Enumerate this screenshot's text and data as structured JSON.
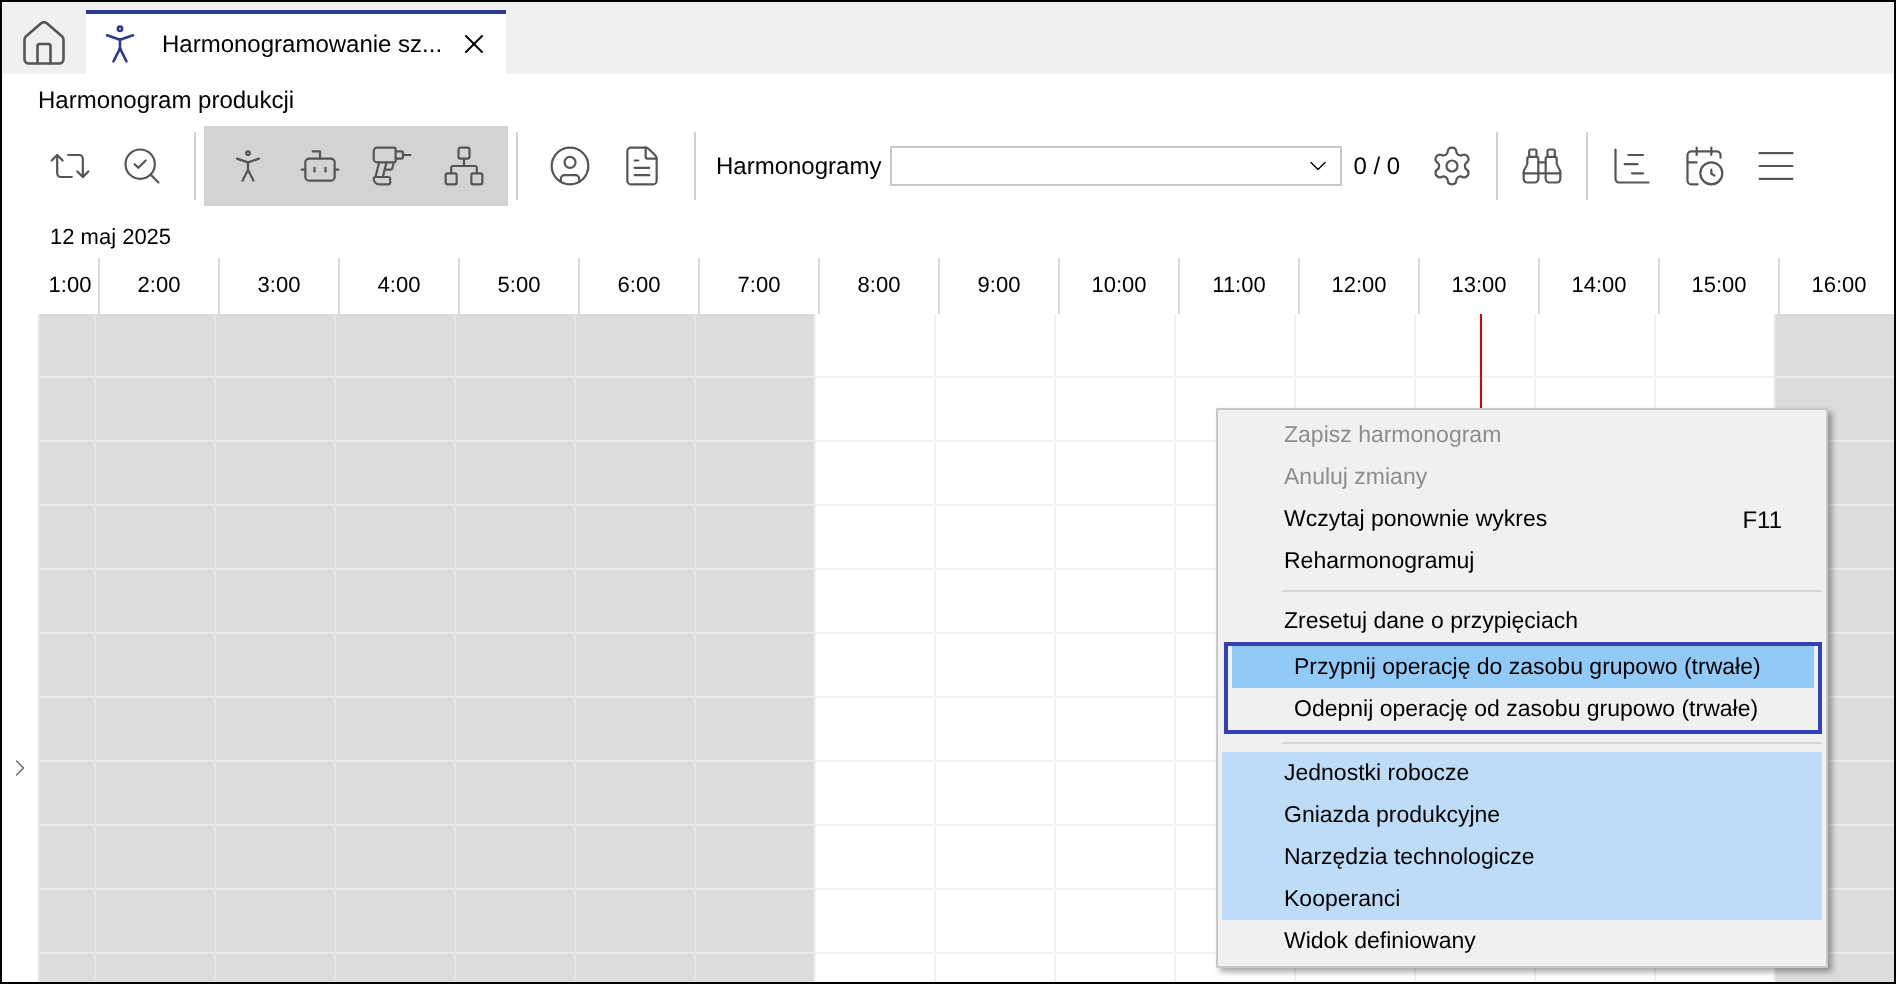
{
  "tabs": [
    {
      "kind": "home",
      "selected": false
    },
    {
      "kind": "document",
      "label": "Harmonogramowanie sz...",
      "selected": true
    }
  ],
  "title": "Harmonogram produkcji",
  "toolbar": {
    "groups": [
      {
        "active": false
      },
      {
        "active": true
      },
      {
        "active": false
      }
    ],
    "combo": {
      "label": "Harmonogramy"
    },
    "counter": "0 / 0"
  },
  "date": "12 maj 2025",
  "hours": [
    {
      "label": "1:00",
      "shaded": true,
      "now": false
    },
    {
      "label": "2:00",
      "shaded": true,
      "now": false
    },
    {
      "label": "3:00",
      "shaded": true,
      "now": false
    },
    {
      "label": "4:00",
      "shaded": true,
      "now": false
    },
    {
      "label": "5:00",
      "shaded": true,
      "now": false
    },
    {
      "label": "6:00",
      "shaded": true,
      "now": false
    },
    {
      "label": "7:00",
      "shaded": true,
      "now": false
    },
    {
      "label": "8:00",
      "shaded": false,
      "now": false
    },
    {
      "label": "9:00",
      "shaded": false,
      "now": false
    },
    {
      "label": "10:00",
      "shaded": false,
      "now": false
    },
    {
      "label": "11:00",
      "shaded": false,
      "now": false
    },
    {
      "label": "12:00",
      "shaded": false,
      "now": false
    },
    {
      "label": "13:00",
      "shaded": false,
      "now": true
    },
    {
      "label": "14:00",
      "shaded": false,
      "now": false
    },
    {
      "label": "15:00",
      "shaded": false,
      "now": false
    },
    {
      "label": "16:00",
      "shaded": true,
      "now": false
    }
  ],
  "context_menu": {
    "sections": [
      [
        {
          "label": "Zapisz harmonogram",
          "disabled": true,
          "selected": false,
          "checked": false,
          "outlined": false
        },
        {
          "label": "Anuluj zmiany",
          "disabled": true,
          "selected": false,
          "checked": false,
          "outlined": false
        },
        {
          "label": "Wczytaj ponownie wykres",
          "shortcut": "F11",
          "disabled": false,
          "selected": false,
          "checked": false,
          "outlined": false
        },
        {
          "label": "Reharmonogramuj",
          "disabled": false,
          "selected": false,
          "checked": false,
          "outlined": false
        }
      ],
      [
        {
          "label": "Zresetuj dane o przypięciach",
          "disabled": false,
          "selected": false,
          "checked": false,
          "outlined": false
        },
        {
          "label": "Przypnij operację do zasobu grupowo (trwałe)",
          "disabled": false,
          "selected": true,
          "checked": false,
          "outlined": true
        },
        {
          "label": "Odepnij operację od zasobu grupowo (trwałe)",
          "disabled": false,
          "selected": false,
          "checked": false,
          "outlined": true
        }
      ],
      [
        {
          "label": "Jednostki robocze",
          "disabled": false,
          "selected": false,
          "checked": true,
          "outlined": false
        },
        {
          "label": "Gniazda produkcyjne",
          "disabled": false,
          "selected": false,
          "checked": true,
          "outlined": false
        },
        {
          "label": "Narzędzia technologicze",
          "disabled": false,
          "selected": false,
          "checked": true,
          "outlined": false
        },
        {
          "label": "Kooperanci",
          "disabled": false,
          "selected": false,
          "checked": true,
          "outlined": false
        },
        {
          "label": "Widok definiowany",
          "disabled": false,
          "selected": false,
          "checked": false,
          "outlined": false
        }
      ]
    ]
  }
}
